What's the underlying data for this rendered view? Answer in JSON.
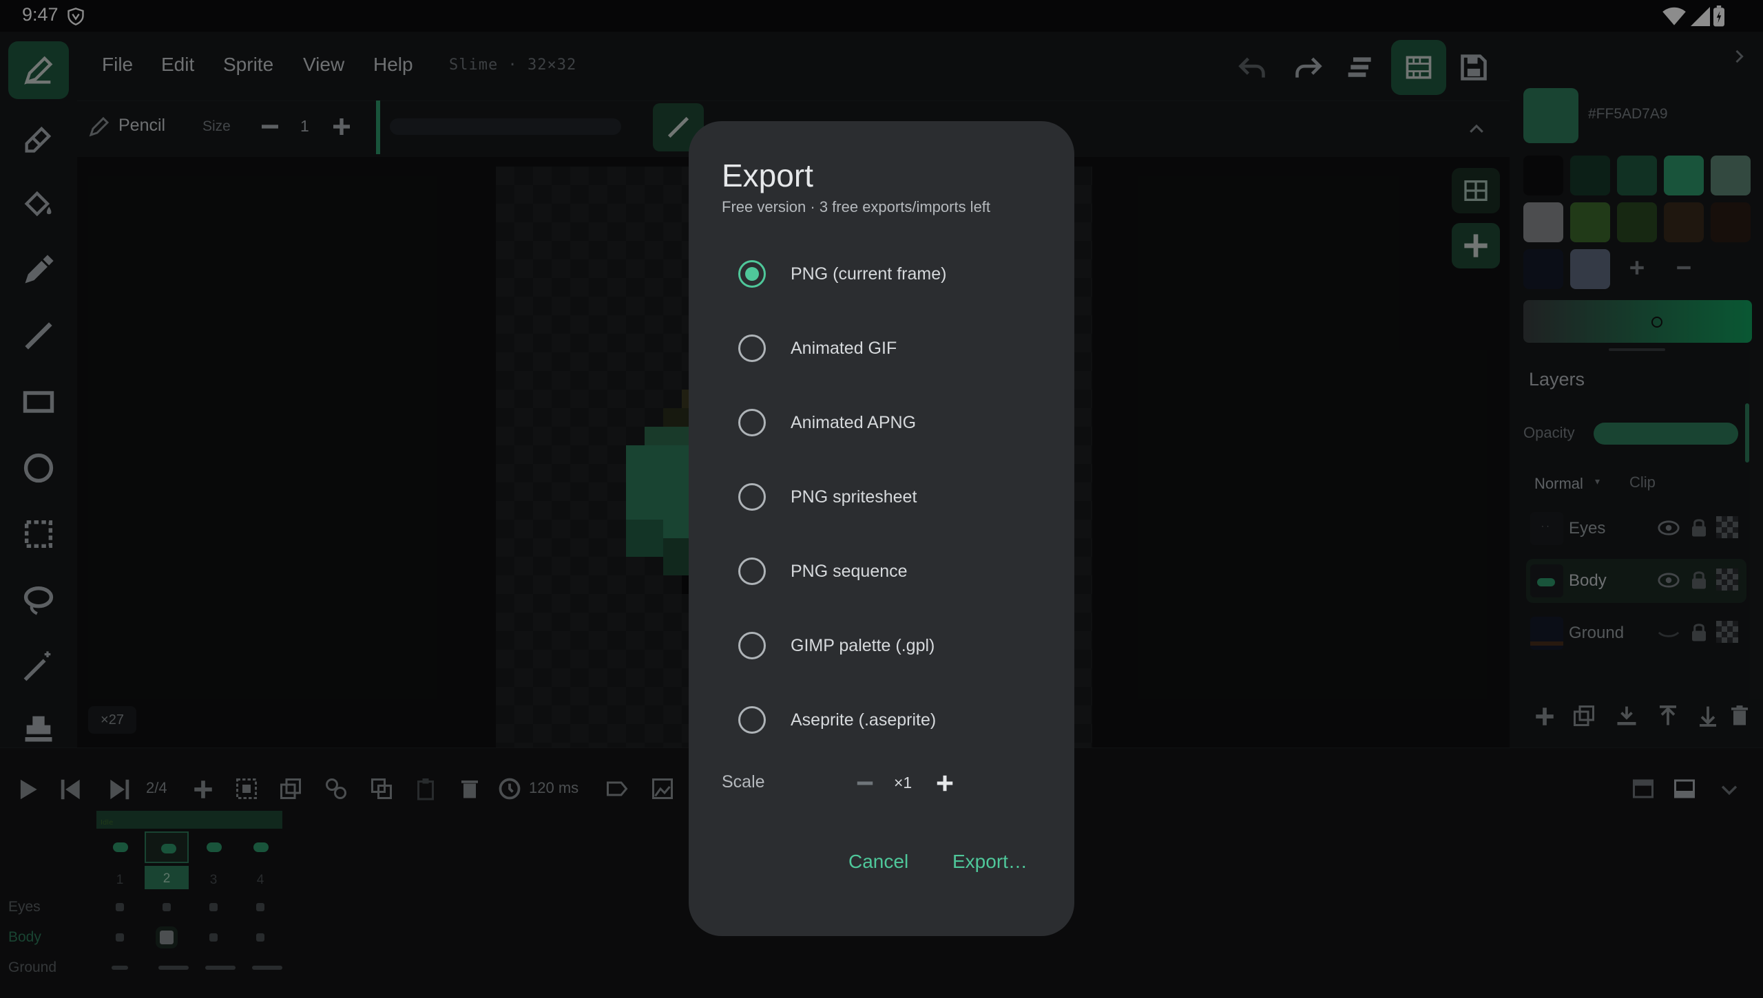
{
  "status": {
    "time": "9:47"
  },
  "menu": {
    "file": "File",
    "edit": "Edit",
    "sprite": "Sprite",
    "view": "View",
    "help": "Help",
    "doc_title": "Slime · 32×32"
  },
  "options": {
    "tool_name": "Pencil",
    "size_label": "Size",
    "size_value": "1"
  },
  "canvas": {
    "zoom": "×27"
  },
  "color": {
    "hex": "#FF5AD7A9",
    "current": "#2e7d5b"
  },
  "palette": [
    "#0d0e10",
    "#173a2b",
    "#1f5a40",
    "#2e9a6c",
    "#5e8676",
    "#8a8d90",
    "#3c6a2c",
    "#2a4a22",
    "#3a2a1c",
    "#2a1c14",
    "#141a2a",
    "#606a80"
  ],
  "layers": {
    "title": "Layers",
    "opacity_label": "Opacity",
    "blend": "Normal",
    "clip": "Clip",
    "items": [
      {
        "name": "Eyes"
      },
      {
        "name": "Body"
      },
      {
        "name": "Ground"
      }
    ]
  },
  "timeline": {
    "frame_counter": "2/4",
    "duration": "120 ms",
    "tag": "Idle",
    "frames": [
      "1",
      "2",
      "3",
      "4"
    ],
    "rows": [
      "Eyes",
      "Body",
      "Ground"
    ]
  },
  "dialog": {
    "title": "Export",
    "subtitle": "Free version · 3 free exports/imports left",
    "selected": 0,
    "options": [
      "PNG (current frame)",
      "Animated GIF",
      "Animated APNG",
      "PNG spritesheet",
      "PNG sequence",
      "GIMP palette (.gpl)",
      "Aseprite (.aseprite)"
    ],
    "scale_label": "Scale",
    "scale_value": "×1",
    "cancel": "Cancel",
    "export": "Export…"
  }
}
